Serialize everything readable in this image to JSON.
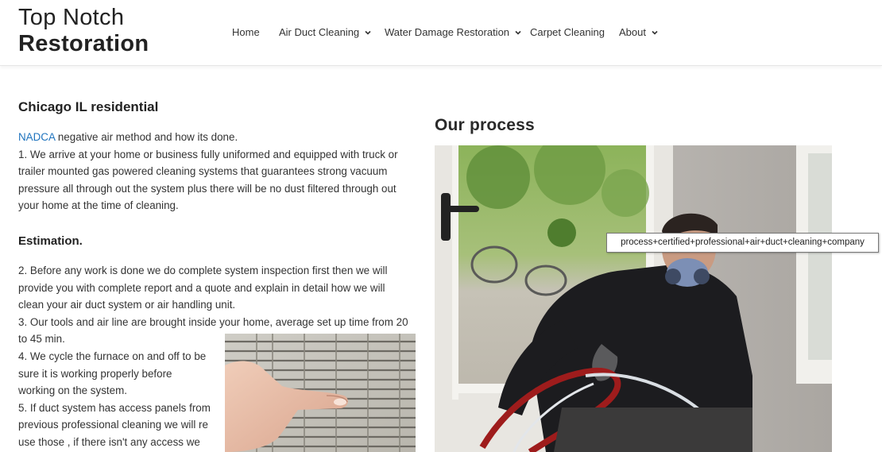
{
  "logo": {
    "line1": "Top Notch",
    "line2": "Restoration"
  },
  "nav": {
    "items": [
      {
        "label": "Home",
        "dropdown": false
      },
      {
        "label": "Air Duct Cleaning",
        "dropdown": true
      },
      {
        "label": "Water Damage Restoration",
        "dropdown": true
      },
      {
        "label": "Carpet Cleaning",
        "dropdown": false
      },
      {
        "label": "About",
        "dropdown": true
      }
    ]
  },
  "left": {
    "heading": "Chicago IL residential",
    "intro_link": "NADCA",
    "intro_rest": " negative air method and how its done.",
    "lines_p1": [
      "1. We arrive at your home or business fully uniformed and equipped with truck or",
      "trailer mounted gas powered cleaning systems that guarantees strong vacuum",
      "pressure all through out the system plus there will be no dust filtered through out",
      "your home at the time of cleaning."
    ],
    "estimation_heading": "Estimation.",
    "lines_p2": [
      "2. Before any work is done we do complete system inspection first then we will",
      "provide you with complete report and a quote and explain in detail how we will",
      "clean your air duct system or air handling unit.",
      "3. Our tools and air line are brought inside your home, average set up time from 20",
      "to 45 min.",
      "4. We cycle the furnace on and off to be",
      "sure it is working properly before",
      "working on the system.",
      "5. If duct system has access panels from",
      "previous professional cleaning we will re",
      "use those , if there isn't any access we"
    ]
  },
  "right": {
    "heading": "Our process",
    "tooltip": "process+certified+professional+air+duct+cleaning+company"
  }
}
